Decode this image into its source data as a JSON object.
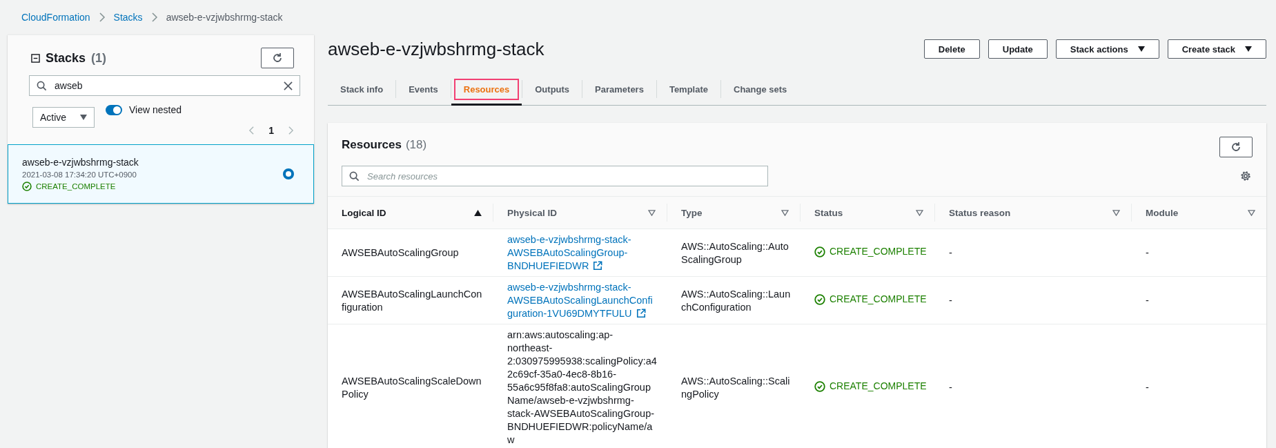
{
  "breadcrumb": [
    {
      "label": "CloudFormation",
      "kind": "link"
    },
    {
      "label": "Stacks",
      "kind": "link"
    },
    {
      "label": "awseb-e-vzjwbshrmg-stack",
      "kind": "current"
    }
  ],
  "stacks_panel": {
    "title": "Stacks",
    "count": "(1)",
    "search": {
      "value": "awseb"
    },
    "filter": "Active",
    "view_nested": {
      "label": "View nested",
      "on": true
    },
    "page": "1",
    "items": [
      {
        "name": "awseb-e-vzjwbshrmg-stack",
        "time": "2021-03-08 17:34:20 UTC+0900",
        "status": "CREATE_COMPLETE",
        "selected": true
      }
    ]
  },
  "stack_title": "awseb-e-vzjwbshrmg-stack",
  "actions": [
    {
      "label": "Delete",
      "kind": "plain"
    },
    {
      "label": "Update",
      "kind": "plain"
    },
    {
      "label": "Stack actions",
      "kind": "dropdown"
    },
    {
      "label": "Create stack",
      "kind": "dropdown"
    }
  ],
  "tabs": [
    {
      "label": "Stack info",
      "selected": false,
      "focused": false
    },
    {
      "label": "Events",
      "selected": false,
      "focused": false
    },
    {
      "label": "Resources",
      "selected": true,
      "focused": true
    },
    {
      "label": "Outputs",
      "selected": false,
      "focused": false
    },
    {
      "label": "Parameters",
      "selected": false,
      "focused": false
    },
    {
      "label": "Template",
      "selected": false,
      "focused": false
    },
    {
      "label": "Change sets",
      "selected": false,
      "focused": false
    }
  ],
  "resources": {
    "title": "Resources",
    "count": "(18)",
    "search": {
      "placeholder": "Search resources"
    },
    "columns": [
      {
        "label": "Logical ID",
        "sorted": true
      },
      {
        "label": "Physical ID",
        "sorted": false
      },
      {
        "label": "Type",
        "sorted": false
      },
      {
        "label": "Status",
        "sorted": false
      },
      {
        "label": "Status reason",
        "sorted": false
      },
      {
        "label": "Module",
        "sorted": false
      }
    ],
    "rows": [
      {
        "logical_id": "AWSEBAutoScalingGroup",
        "physical_id": "awseb-e-vzjwbshrmg-stack-AWSEBAutoScalingGroup-BNDHUEFIEDWR",
        "kind": "link",
        "type": "AWS::AutoScaling::AutoScalingGroup",
        "status": "CREATE_COMPLETE",
        "status_reason": "-",
        "module": "-"
      },
      {
        "logical_id": "AWSEBAutoScalingLaunchConfiguration",
        "physical_id": "awseb-e-vzjwbshrmg-stack-AWSEBAutoScalingLaunchConfiguration-1VU69DMYTFULU",
        "kind": "link",
        "type": "AWS::AutoScaling::LaunchConfiguration",
        "status": "CREATE_COMPLETE",
        "status_reason": "-",
        "module": "-"
      },
      {
        "logical_id": "AWSEBAutoScalingScaleDownPolicy",
        "physical_id": "arn:aws:autoscaling:ap-northeast-2:030975995938:scalingPolicy:a42c69cf-35a0-4ec8-8b16-55a6c95f8fa8:autoScalingGroupName/awseb-e-vzjwbshrmg-stack-AWSEBAutoScalingGroup-BNDHUEFIEDWR:policyName/aw",
        "kind": "text",
        "type": "AWS::AutoScaling::ScalingPolicy",
        "status": "CREATE_COMPLETE",
        "status_reason": "-",
        "module": "-"
      }
    ]
  }
}
